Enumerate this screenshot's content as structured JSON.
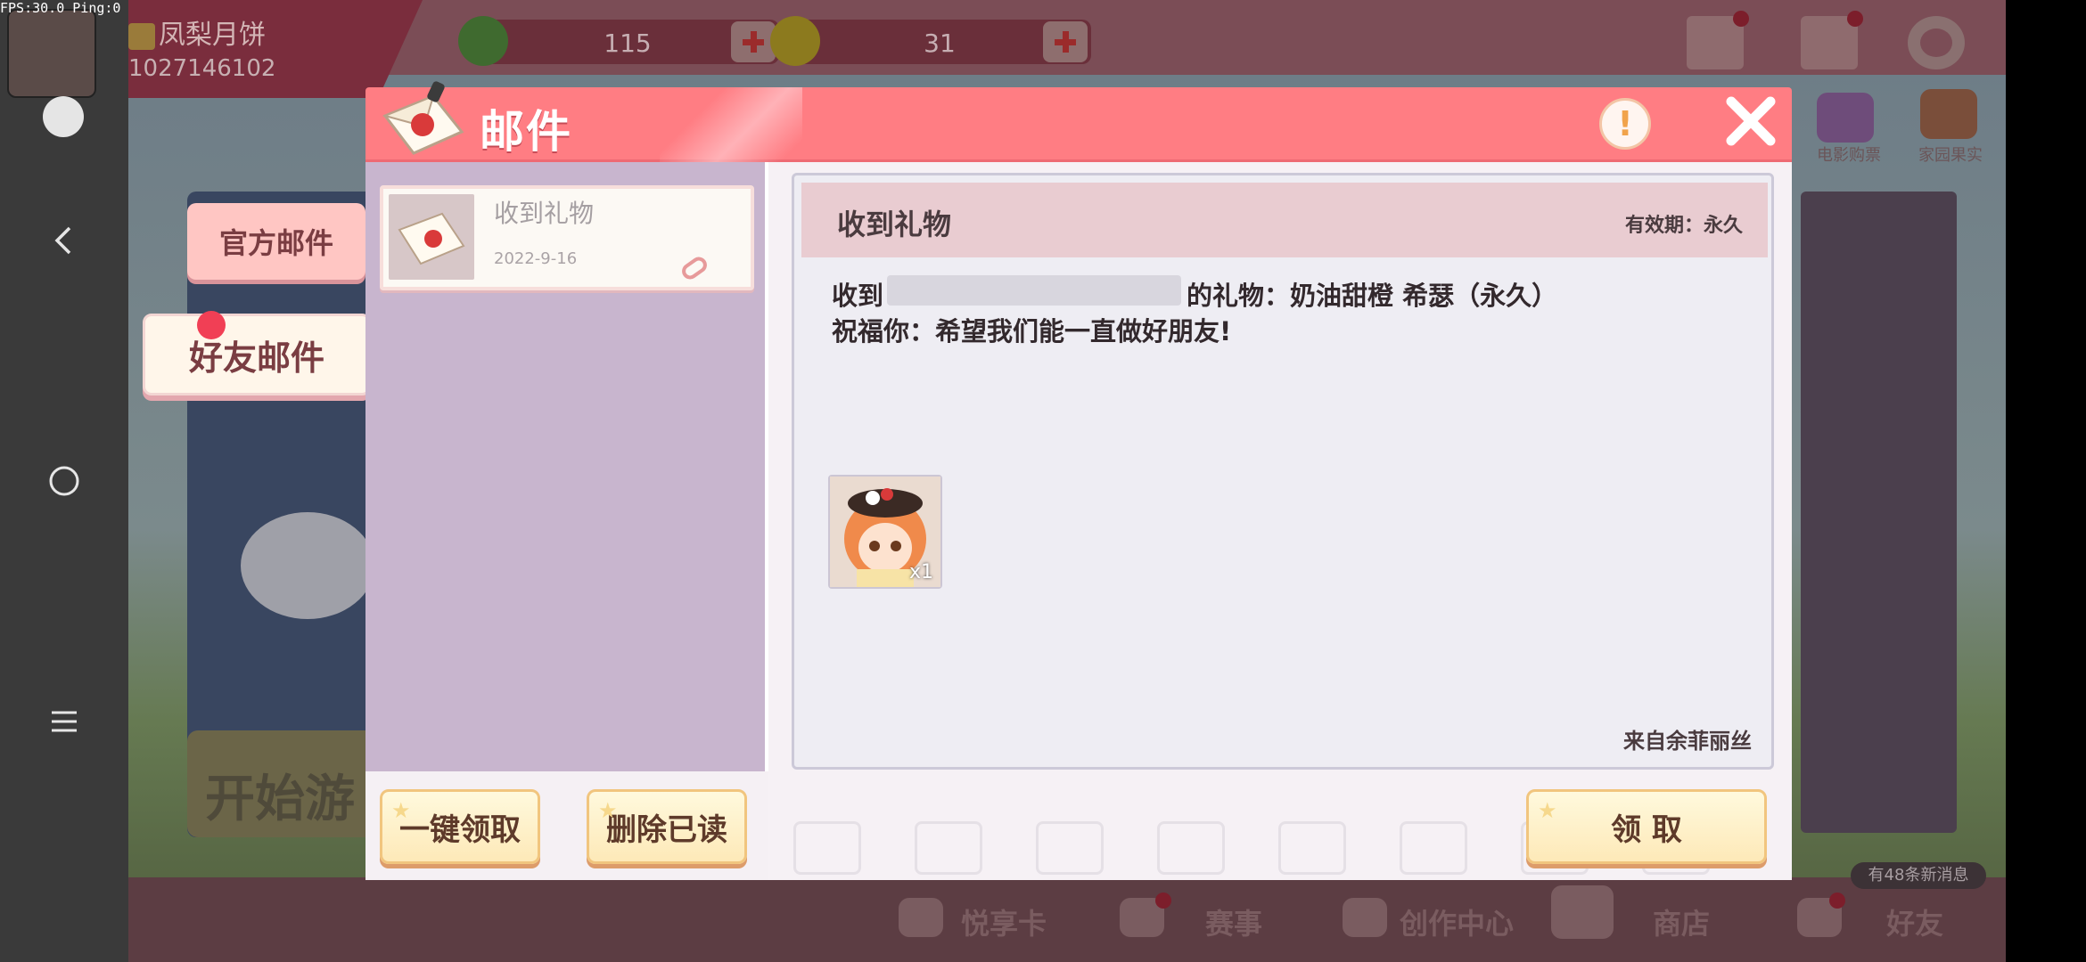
{
  "overlay": {
    "fps_label": "FPS:30.0  Ping:0"
  },
  "player": {
    "name": "凤梨月饼",
    "id": "1027146102"
  },
  "currencies": [
    {
      "name": "green-gem",
      "amount": "115",
      "color": "#3f6a2f"
    },
    {
      "name": "gold-coin",
      "amount": "31",
      "color": "#8c7a1e"
    }
  ],
  "side_icons": [
    {
      "label": "电影购票"
    },
    {
      "label": "家园果实"
    }
  ],
  "start_game_label": "开始游",
  "bottom_nav": [
    {
      "label": "悦享卡"
    },
    {
      "label": "赛事"
    },
    {
      "label": "创作中心"
    },
    {
      "label": "商店"
    },
    {
      "label": "好友"
    }
  ],
  "message_badge": "有48条新消息",
  "mail_dialog": {
    "title": "邮件",
    "info_symbol": "!",
    "tabs": [
      {
        "label": "官方邮件",
        "active": false
      },
      {
        "label": "好友邮件",
        "active": true
      }
    ],
    "mail_list": [
      {
        "title": "收到礼物",
        "date": "2022-9-16"
      }
    ],
    "buttons": {
      "claim_all": "一键领取",
      "delete_read": "删除已读",
      "claim": "领 取"
    },
    "detail": {
      "title": "收到礼物",
      "validity": "有效期：永久",
      "line1_prefix": "收到",
      "line1_suffix": "的礼物：奶油甜橙 希瑟（永久）",
      "line2": "祝福你：希望我们能一直做好朋友!",
      "attachment_qty": "x1",
      "sender": "来自余菲丽丝"
    }
  },
  "colors": {
    "header_pink": "#ff7d83",
    "list_lilac": "#c8b5ce",
    "button_cream": "#fde9b8",
    "badge_red": "#f13f55"
  }
}
